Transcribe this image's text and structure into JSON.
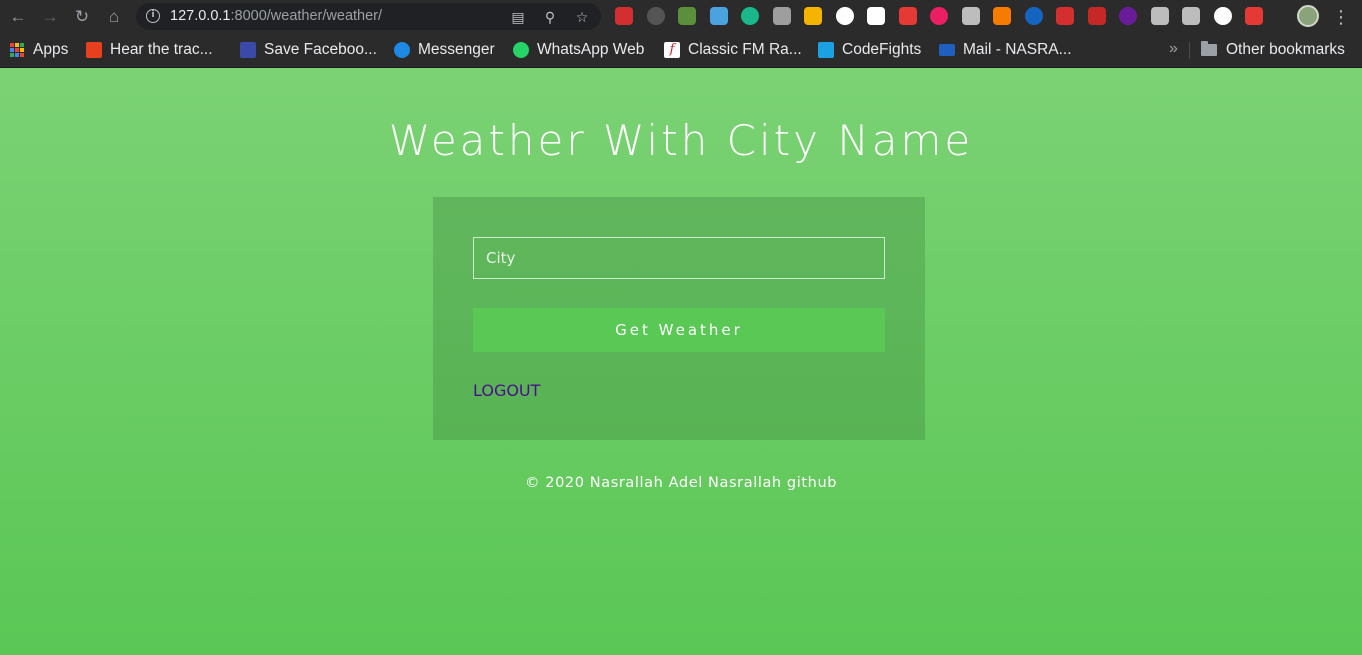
{
  "browser": {
    "url_host": "127.0.0.1",
    "url_path": ":8000/weather/weather/",
    "bookmarks": [
      {
        "label": "Apps",
        "color": "#e9573f"
      },
      {
        "label": "Hear the trac...",
        "color": "#e8401f"
      },
      {
        "label": "Save Faceboo...",
        "color": "#3b4aa8"
      },
      {
        "label": "Messenger",
        "color": "#1e88e5"
      },
      {
        "label": "WhatsApp Web",
        "color": "#25d366"
      },
      {
        "label": "Classic FM Ra...",
        "color": "#ffffff"
      },
      {
        "label": "CodeFights",
        "color": "#1ba1e2"
      },
      {
        "label": "Mail - NASRA...",
        "color": "#1f5fbf"
      }
    ],
    "other_bookmarks": "Other bookmarks",
    "chevron": "»",
    "extension_colors": [
      "#d32f2f",
      "#555555",
      "#5c8f3c",
      "#4aa3df",
      "#19b78a",
      "#9e9e9e",
      "#f4b400",
      "#ffffff",
      "#ffffff",
      "#e53935",
      "#e91e63",
      "#bdbdbd",
      "#f57c00",
      "#1565c0",
      "#d32f2f",
      "#c62828",
      "#6a1b9a",
      "#bdbdbd",
      "#bdbdbd",
      "#ffffff",
      "#e53935"
    ]
  },
  "page": {
    "title": "Weather With City Name",
    "city_placeholder": "City",
    "button_label": "Get Weather",
    "logout_label": "LOGOUT",
    "footer": "© 2020 Nasrallah Adel Nasrallah github"
  }
}
